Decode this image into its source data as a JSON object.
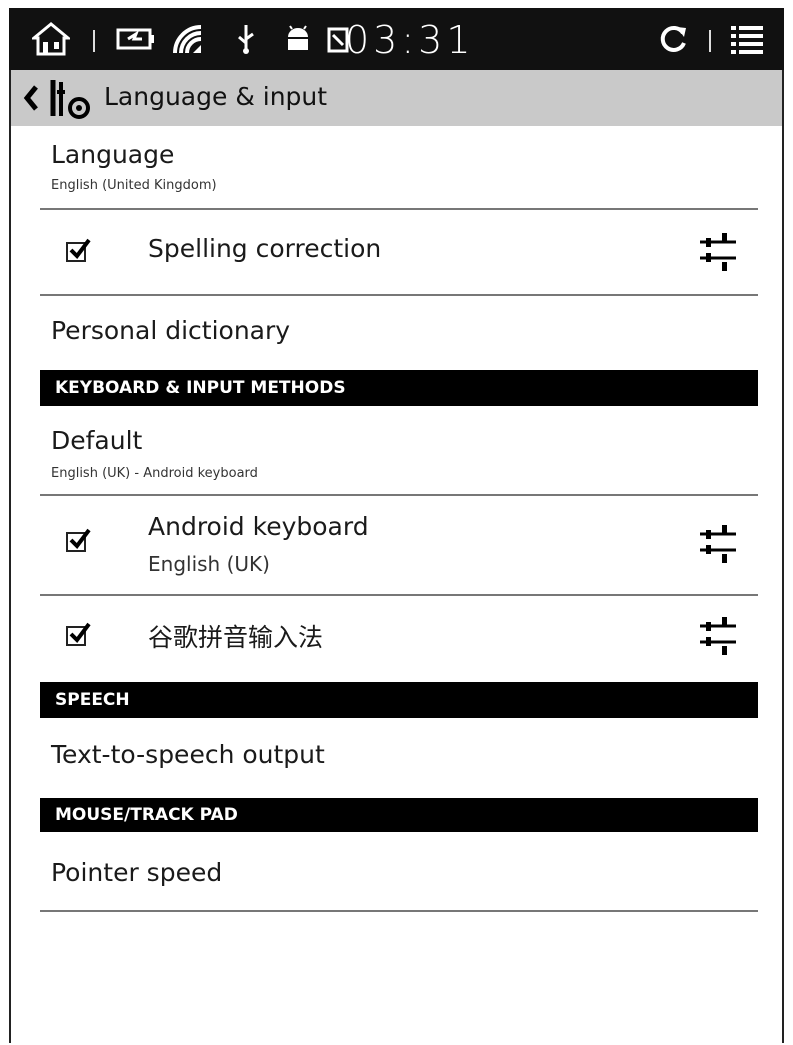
{
  "status_bar": {
    "time": "03:31",
    "icons": [
      "home-icon",
      "battery-charging-icon",
      "wifi-icon",
      "usb-icon",
      "android-icon",
      "sim-icon",
      "refresh-icon",
      "menu-icon"
    ]
  },
  "action_bar": {
    "title": "Language & input",
    "back_icon": "chevron-left-icon",
    "app_icon": "settings-tools-icon"
  },
  "items": {
    "language": {
      "title": "Language",
      "summary": "English (United Kingdom)"
    },
    "spelling": {
      "title": "Spelling correction",
      "checked": true
    },
    "dictionary": {
      "title": "Personal dictionary"
    },
    "default": {
      "title": "Default",
      "summary": "English (UK) - Android keyboard"
    },
    "android_keyboard": {
      "title": "Android keyboard",
      "summary": "English (UK)",
      "checked": true
    },
    "pinyin": {
      "title": "谷歌拼音输入法",
      "checked": true
    },
    "tts": {
      "title": "Text-to-speech output"
    },
    "pointer": {
      "title": "Pointer speed"
    }
  },
  "headers": {
    "keyboard": "KEYBOARD & INPUT METHODS",
    "speech": "SPEECH",
    "mouse": "MOUSE/TRACK PAD"
  },
  "colors": {
    "status_bar_bg": "#111111",
    "action_bar_bg": "#c9c9c9",
    "header_bg": "#000000"
  }
}
